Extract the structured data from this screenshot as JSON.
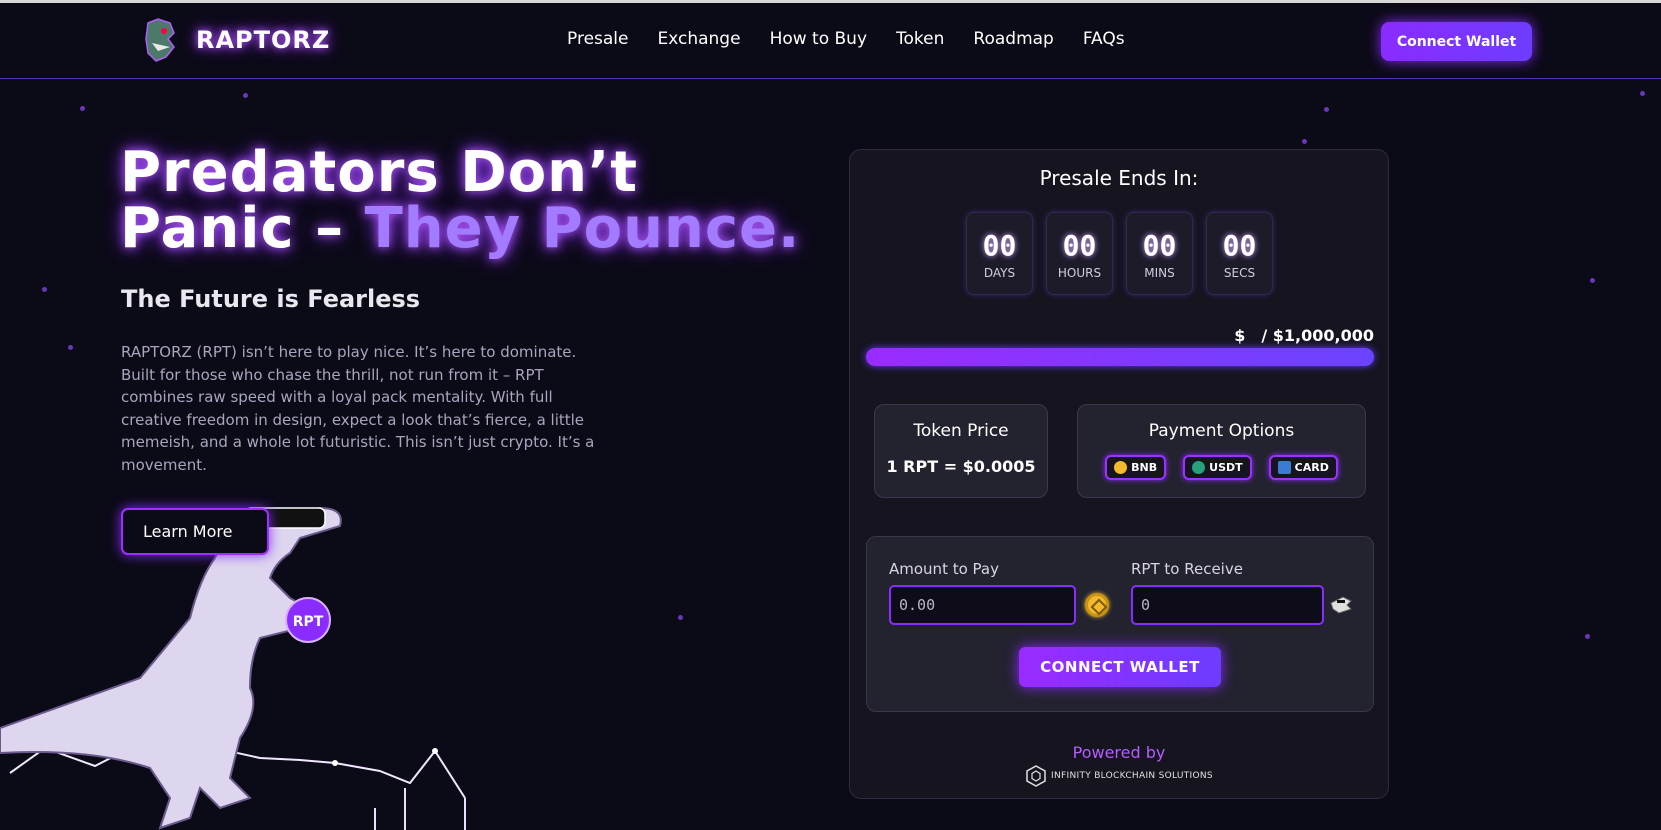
{
  "brand": {
    "name": "RAPTORZ"
  },
  "nav": {
    "links": [
      "Presale",
      "Exchange",
      "How to Buy",
      "Token",
      "Roadmap",
      "FAQs"
    ],
    "connect_label": "Connect Wallet"
  },
  "hero": {
    "title_line1": "Predators Don’t",
    "title_line2_prefix": "Panic – ",
    "title_line2_accent": "They Pounce.",
    "subtitle": "The Future is Fearless",
    "description": "RAPTORZ (RPT) isn’t here to play nice. It’s here to dominate. Built for those who chase the thrill, not run from it – RPT combines raw speed with a loyal pack mentality. With full creative freedom in design, expect a look that’s fierce, a little memeish, and a whole lot futuristic. This isn’t just crypto. It’s a movement.",
    "learn_more_label": "Learn More",
    "coin_label": "RPT"
  },
  "presale": {
    "title": "Presale Ends In:",
    "countdown": [
      {
        "value": "00",
        "label": "DAYS"
      },
      {
        "value": "00",
        "label": "HOURS"
      },
      {
        "value": "00",
        "label": "MINS"
      },
      {
        "value": "00",
        "label": "SECS"
      }
    ],
    "raised_currency": "$",
    "raised_target": "/ $1,000,000",
    "progress_fraction": 1.0,
    "token_price_title": "Token Price",
    "token_price_value": "1 RPT = $0.0005",
    "payment_title": "Payment Options",
    "payment_options": [
      "BNB",
      "USDT",
      "CARD"
    ],
    "amount_label": "Amount to Pay",
    "amount_placeholder": "0.00",
    "receive_label": "RPT to Receive",
    "receive_placeholder": "0",
    "connect_label": "CONNECT WALLET",
    "powered_by": "Powered by",
    "partner": "INFINITY BLOCKCHAIN SOLUTIONS"
  },
  "colors": {
    "accent": "#8a2cff",
    "accent_light": "#a37bff",
    "background": "#0b0a17"
  }
}
